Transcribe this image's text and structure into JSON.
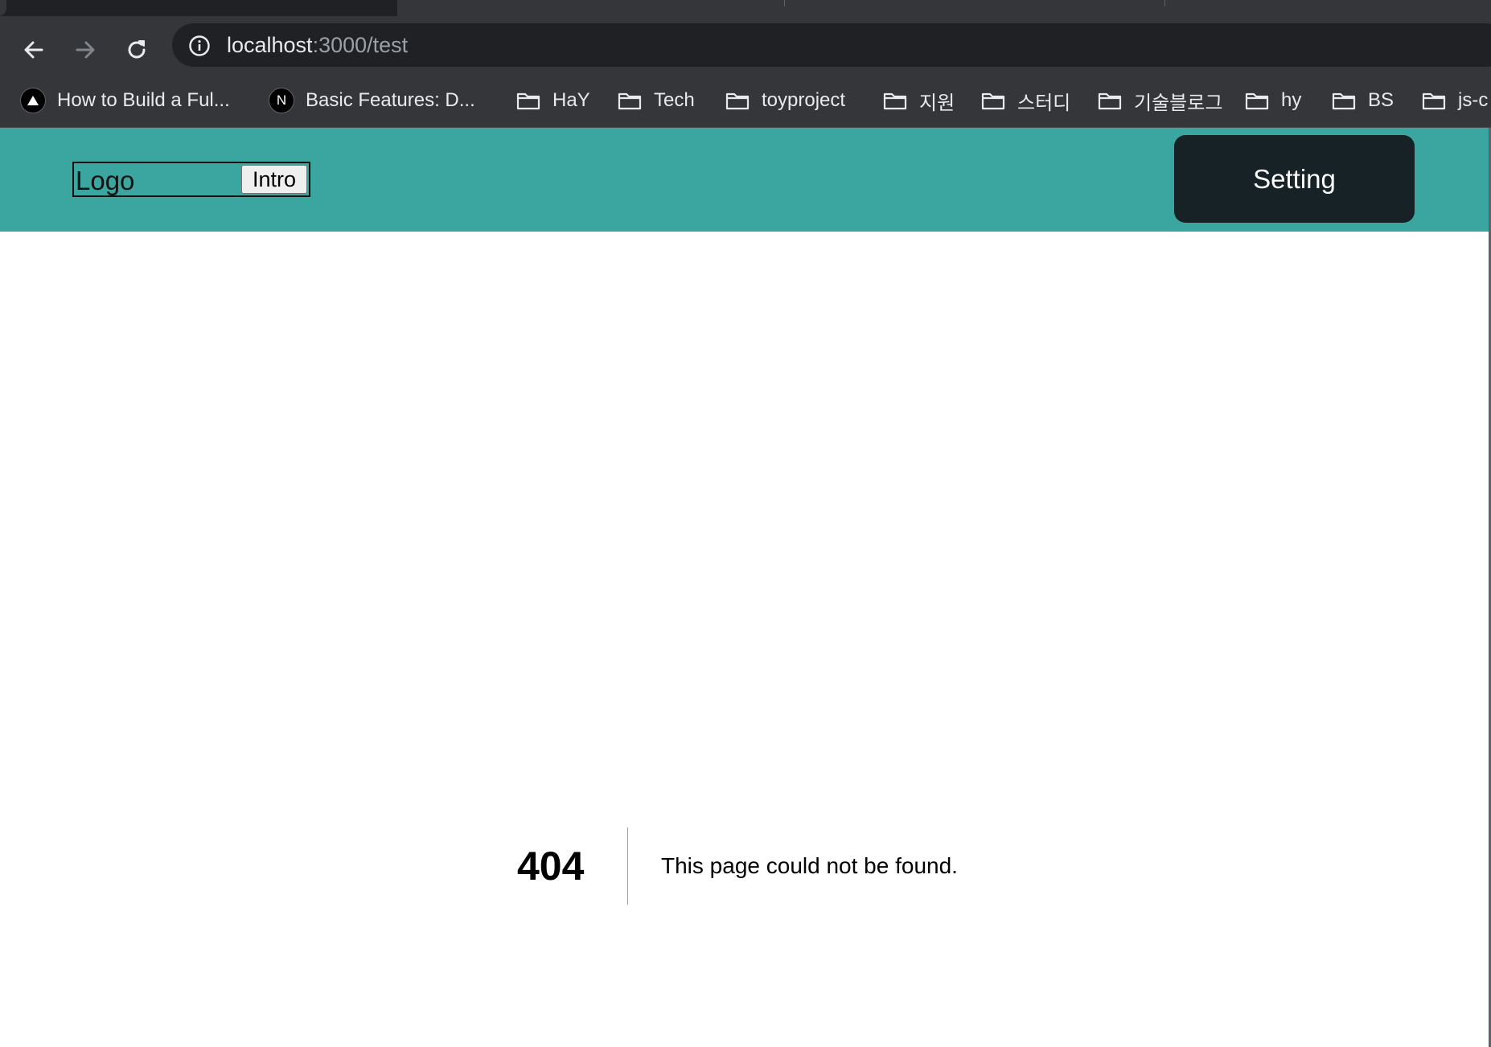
{
  "browser": {
    "url_host": "localhost",
    "url_rest": ":3000/test",
    "bookmarks": [
      {
        "label": "How to Build a Ful...",
        "icon": "triangle-logo-icon"
      },
      {
        "label": "Basic Features: D...",
        "icon": "nextjs-logo-icon",
        "icon_text": "N"
      },
      {
        "label": "HaY",
        "icon": "folder-icon"
      },
      {
        "label": "Tech",
        "icon": "folder-icon"
      },
      {
        "label": "toyproject",
        "icon": "folder-icon"
      },
      {
        "label": "지원",
        "icon": "folder-icon"
      },
      {
        "label": "스터디",
        "icon": "folder-icon"
      },
      {
        "label": "기술블로그",
        "icon": "folder-icon"
      },
      {
        "label": "hy",
        "icon": "folder-icon"
      },
      {
        "label": "BS",
        "icon": "folder-icon"
      },
      {
        "label": "js-c",
        "icon": "folder-icon"
      }
    ]
  },
  "header": {
    "logo": "Logo",
    "intro_label": "Intro",
    "setting_label": "Setting"
  },
  "error": {
    "code": "404",
    "message": "This page could not be found."
  },
  "colors": {
    "header_bg": "#3ba6a0",
    "setting_bg": "#162226",
    "chrome_bg": "#35363a",
    "omnibox_bg": "#202124"
  }
}
